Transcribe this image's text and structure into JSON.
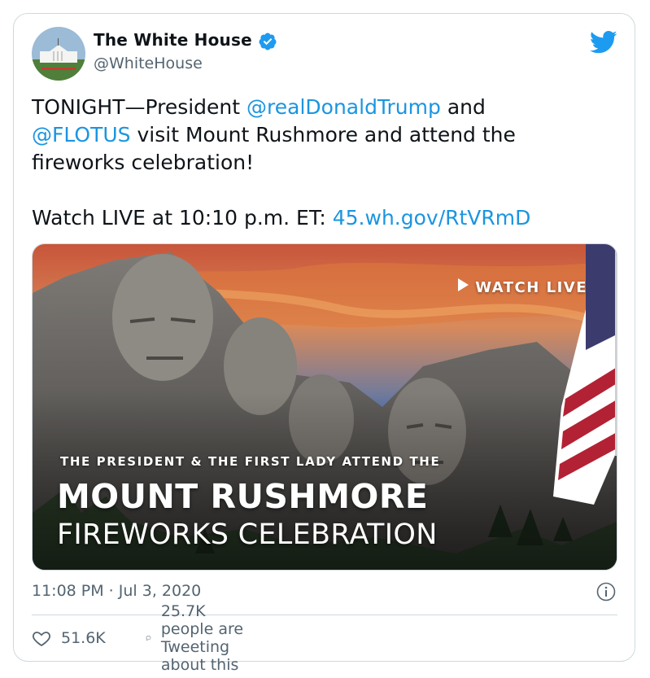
{
  "author": {
    "name": "The White House",
    "handle": "@WhiteHouse",
    "verified": true
  },
  "tweet": {
    "line1_prefix": "TONIGHT—President ",
    "mention1": "@realDonaldTrump",
    "line1_suffix": " and",
    "mention2": "@FLOTUS",
    "line2_suffix": " visit Mount Rushmore and attend the",
    "line3": "fireworks celebration!",
    "line4_prefix": "Watch LIVE at 10:10 p.m. ET: ",
    "link": "45.wh.gov/RtVRmD"
  },
  "media": {
    "watch_live": "WATCH LIVE",
    "pre_title": "THE PRESIDENT & THE FIRST LADY ATTEND THE",
    "title_main": "MOUNT RUSHMORE",
    "title_sub": "FIREWORKS CELEBRATION"
  },
  "meta": {
    "timestamp": "11:08 PM · Jul 3, 2020"
  },
  "actions": {
    "likes": "51.6K",
    "tweeting": "25.7K people are Tweeting about this"
  },
  "colors": {
    "link": "#1b95e0",
    "verified": "#1d9bf0",
    "twitter_bird": "#1d9bf0",
    "secondary_text": "#536471"
  },
  "icons": [
    "twitter-bird-icon",
    "verified-badge-icon",
    "info-icon",
    "heart-icon",
    "speech-bubble-icon",
    "play-triangle-icon"
  ]
}
